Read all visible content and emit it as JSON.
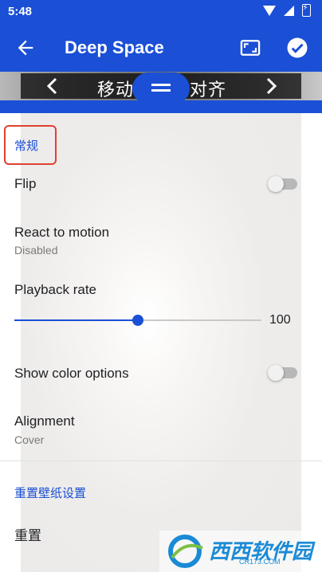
{
  "status_bar": {
    "time": "5:48"
  },
  "app_bar": {
    "title": "Deep Space"
  },
  "preview": {
    "text_left": "移动",
    "text_right": "对齐"
  },
  "sections": {
    "general": "常规",
    "reset_section": "重置壁纸设置"
  },
  "settings": {
    "flip": {
      "label": "Flip",
      "enabled": false
    },
    "react_to_motion": {
      "label": "React to motion",
      "value": "Disabled"
    },
    "playback_rate": {
      "label": "Playback rate",
      "value": "100",
      "level": 0.5
    },
    "show_color_options": {
      "label": "Show color options",
      "enabled": false
    },
    "alignment": {
      "label": "Alignment",
      "value": "Cover"
    },
    "reset": {
      "label": "重置"
    }
  },
  "watermark": {
    "text": "西西软件园",
    "sub": "CR173.COM"
  },
  "colors": {
    "primary": "#1a4fd6",
    "highlight_box": "#e0402f"
  },
  "icons": {
    "back": "arrow-left",
    "preview": "fullscreen-frame",
    "apply": "check-circle",
    "prev": "chevron-left",
    "next": "chevron-right",
    "handle": "drag-handle"
  }
}
